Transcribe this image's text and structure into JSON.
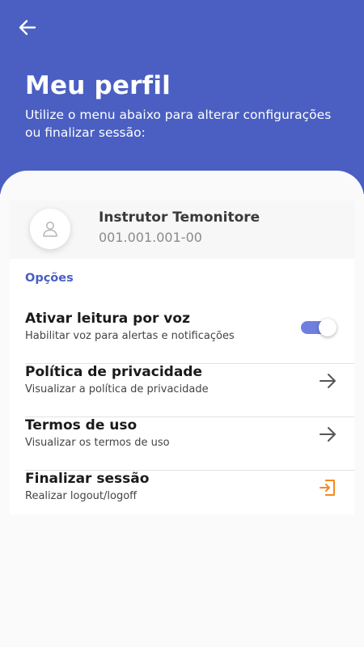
{
  "header": {
    "title": "Meu perfil",
    "subtitle": "Utilize o menu abaixo para alterar configurações ou finalizar sessão:",
    "background_color": "#4a5fc1",
    "back_icon": "arrow-left-icon"
  },
  "profile": {
    "name": "Instrutor Temonitore",
    "id": "001.001.001-00",
    "avatar_icon": "user-icon"
  },
  "options": {
    "section_title": "Opções",
    "accent_color": "#4a5fc1",
    "items": [
      {
        "title": "Ativar leitura por voz",
        "description": "Habilitar voz para alertas e notificações",
        "control": "toggle",
        "toggle_on": true
      },
      {
        "title": "Política de privacidade",
        "description": "Visualizar a política de privacidade",
        "control": "arrow-right-icon"
      },
      {
        "title": "Termos de uso",
        "description": "Visualizar os termos de uso",
        "control": "arrow-right-icon"
      },
      {
        "title": "Finalizar sessão",
        "description": "Realizar logout/logoff",
        "control": "logout-icon",
        "control_color": "#f28c1e"
      }
    ]
  }
}
